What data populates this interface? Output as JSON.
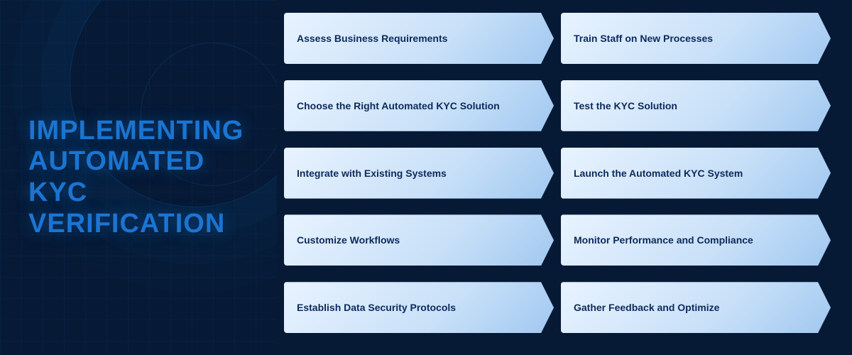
{
  "title": {
    "line1": "IMPLEMENTING",
    "line2": "AUTOMATED KYC",
    "line3": "VERIFICATION"
  },
  "buttons": {
    "col1": [
      {
        "id": "assess",
        "label": "Assess Business Requirements"
      },
      {
        "id": "choose",
        "label": "Choose the Right Automated KYC Solution"
      },
      {
        "id": "integrate",
        "label": "Integrate with Existing Systems"
      },
      {
        "id": "customize",
        "label": "Customize Workflows"
      },
      {
        "id": "establish",
        "label": "Establish Data Security Protocols"
      }
    ],
    "col2": [
      {
        "id": "train",
        "label": "Train Staff on New Processes"
      },
      {
        "id": "test",
        "label": "Test the KYC Solution"
      },
      {
        "id": "launch",
        "label": "Launch the Automated KYC System"
      },
      {
        "id": "monitor",
        "label": "Monitor Performance and Compliance"
      },
      {
        "id": "gather",
        "label": "Gather Feedback and Optimize"
      }
    ]
  }
}
